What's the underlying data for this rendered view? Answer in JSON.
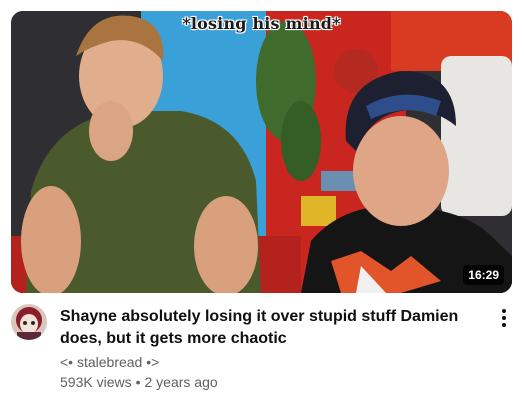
{
  "video": {
    "thumbnail_caption": "*losing his mind*",
    "duration": "16:29",
    "title": "Shayne absolutely losing it over stupid stuff Damien does, but it gets more chaotic",
    "channel": "<• stalebread •>",
    "views": "593K views",
    "separator": "•",
    "age": "2 years ago"
  },
  "icons": {
    "menu": "more-vertical-icon"
  }
}
